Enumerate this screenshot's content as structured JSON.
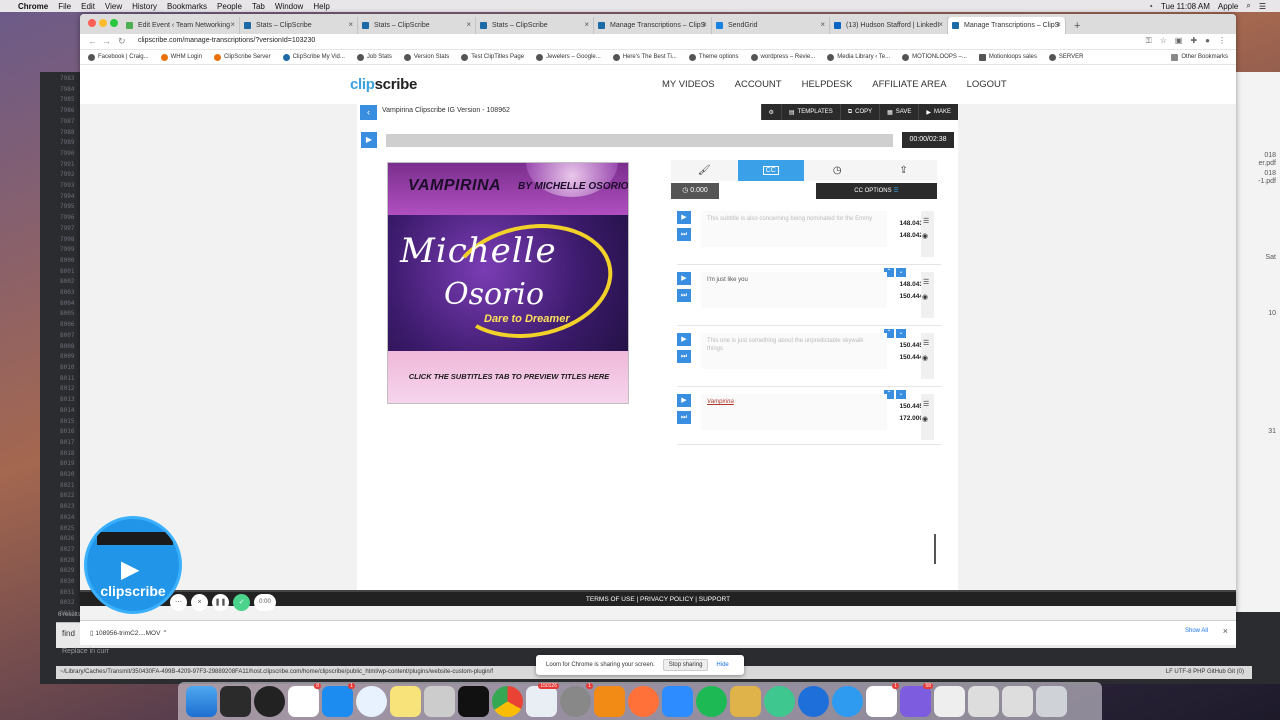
{
  "menubar": {
    "app": "Chrome",
    "items": [
      "File",
      "Edit",
      "View",
      "History",
      "Bookmarks",
      "People",
      "Tab",
      "Window",
      "Help"
    ],
    "clock": "Tue 11:08 AM",
    "user": "Apple"
  },
  "browser": {
    "tabs": [
      {
        "title": "Edit Event ‹ Team Networking"
      },
      {
        "title": "Stats – ClipScribe"
      },
      {
        "title": "Stats – ClipScribe"
      },
      {
        "title": "Stats – ClipScribe"
      },
      {
        "title": "Manage Transcriptions – ClipS"
      },
      {
        "title": "SendGrid"
      },
      {
        "title": "(13) Hudson Stafford | LinkedI"
      },
      {
        "title": "Manage Transcriptions – ClipS"
      }
    ],
    "url": "clipscribe.com/manage-transcriptions/?versionId=103230",
    "bookmarks": [
      "Facebook | Craig...",
      "WHM Login",
      "ClipScribe Server",
      "ClipScribe My Vid...",
      "Job Stats",
      "Version Stats",
      "Test ClipTitles Page",
      "Jewelers – Google...",
      "Here's The Best Ti...",
      "Theme options",
      "wordpress – Revie...",
      "Media Library ‹ Te...",
      "MOTIONLOOPS –...",
      "Motionloops sales",
      "SERVER"
    ],
    "other_bookmarks": "Other Bookmarks"
  },
  "site": {
    "logo_clip": "clip",
    "logo_scribe": "scribe",
    "nav": [
      "MY VIDEOS",
      "ACCOUNT",
      "HELPDESK",
      "AFFILIATE AREA",
      "LOGOUT"
    ],
    "project_title": "Vampirina Clipscribe IG Version - 108962",
    "toolbar": {
      "templates": "TEMPLATES",
      "copy": "COPY",
      "save": "SAVE",
      "make": "MAKE"
    },
    "time": "00:00/02:38",
    "thumbnail": {
      "title": "VAMPIRINA",
      "byline": "BY MICHELLE OSORIO",
      "name_first": "Michelle",
      "name_last": "Osorio",
      "tagline": "Dare to Dreamer",
      "cta": "CLICK THE SUBTITLES TAB TO PREVIEW TITLES HERE"
    },
    "timer": "0.000",
    "cc_options": "CC OPTIONS",
    "subtitles": [
      {
        "text": "This subtitle is also concerning being nominated for the Emmy",
        "start": "148.043",
        "end": "148.042",
        "style": "faint"
      },
      {
        "text": "I'm just like you",
        "start": "148.043",
        "end": "150.444",
        "style": "dark"
      },
      {
        "text": "This one is just something about the unpredictable skywalk things",
        "start": "150.445",
        "end": "150.444",
        "style": "faint"
      },
      {
        "text": "Vampirina",
        "start": "150.445",
        "end": "172.000",
        "style": "link"
      }
    ],
    "footer": {
      "terms": "TERMS OF USE",
      "privacy": "PRIVACY POLICY",
      "support": "SUPPORT"
    }
  },
  "downloads": {
    "file": "108956-trimC2....MOV",
    "show_all": "Show All"
  },
  "loom": {
    "brand": "clipscribe",
    "time": "0:00",
    "share_text": "Loom for Chrome is sharing your screen.",
    "stop": "Stop sharing",
    "hide": "Hide"
  },
  "editor": {
    "find_label": "find",
    "replace_placeholder": "Replace in curr",
    "results": "6 results",
    "status_path": "~/Library/Caches/Transmit/350430FA-499B-4209-97F3-29889208FA11/host.clipscribe.com/home/clipscribe/public_html/wp-content/plugins/website-custom-plugin/f",
    "status_right": "LF   UTF-8   PHP   GitHub   Git (0)",
    "gutter_numbers": [
      "7983",
      "7984",
      "7985",
      "7986",
      "7987",
      "7988",
      "7989",
      "7990",
      "7991",
      "7992",
      "7993",
      "7994",
      "7995",
      "7996",
      "7997",
      "7998",
      "7999",
      "8000",
      "8001",
      "8002",
      "8003",
      "8004",
      "8005",
      "8006",
      "8007",
      "8008",
      "8009",
      "8010",
      "8011",
      "8012",
      "8013",
      "8014",
      "8015",
      "8016",
      "8017",
      "8018",
      "8019",
      "8020",
      "8021",
      "8022",
      "8023",
      "8024",
      "8025",
      "8026",
      "8027",
      "8028",
      "8029",
      "8030",
      "8031",
      "8032",
      "8033"
    ],
    "side_labels": [
      "018",
      "er.pdf",
      "018",
      "-1.pdf",
      "Sat",
      "10",
      "31"
    ]
  }
}
